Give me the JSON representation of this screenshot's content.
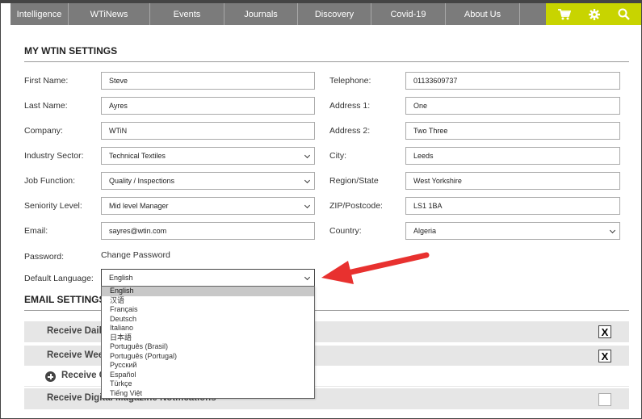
{
  "nav": {
    "items": [
      "Intelligence",
      "WTiNews",
      "Events",
      "Journals",
      "Discovery",
      "Covid-19",
      "About Us"
    ]
  },
  "icons": {
    "cart": "cart-icon",
    "settings": "gear-icon",
    "search": "search-icon"
  },
  "colors": {
    "nav_bg": "#7b7b7b",
    "accent": "#c8d400",
    "arrow": "#e8312f",
    "row_bg": "#e6e6e6"
  },
  "wtin_settings": {
    "title": "MY WTIN SETTINGS",
    "first_name": {
      "label": "First Name:",
      "value": "Steve"
    },
    "last_name": {
      "label": "Last Name:",
      "value": "Ayres"
    },
    "company": {
      "label": "Company:",
      "value": "WTiN"
    },
    "industry_sector": {
      "label": "Industry Sector:",
      "value": "Technical Textiles"
    },
    "job_function": {
      "label": "Job Function:",
      "value": "Quality / Inspections"
    },
    "seniority_level": {
      "label": "Seniority Level:",
      "value": "Mid level Manager"
    },
    "email": {
      "label": "Email:",
      "value": "sayres@wtin.com"
    },
    "password": {
      "label": "Password:",
      "link": "Change Password"
    },
    "default_language": {
      "label": "Default Language:",
      "value": "English"
    },
    "telephone": {
      "label": "Telephone:",
      "value": "01133609737"
    },
    "address1": {
      "label": "Address 1:",
      "value": "One"
    },
    "address2": {
      "label": "Address 2:",
      "value": "Two Three"
    },
    "city": {
      "label": "City:",
      "value": "Leeds"
    },
    "region": {
      "label": "Region/State",
      "value": "West Yorkshire"
    },
    "zip": {
      "label": "ZIP/Postcode:",
      "value": "LS1 1BA"
    },
    "country": {
      "label": "Country:",
      "value": "Algeria"
    }
  },
  "language_options": [
    "English",
    "汉语",
    "Français",
    "Deutsch",
    "Italiano",
    "日本語",
    "Português (Brasil)",
    "Português (Portugal)",
    "Русский",
    "Español",
    "Türkçe",
    "Tiếng Việt"
  ],
  "email_settings": {
    "title": "EMAIL SETTINGS",
    "rows": [
      {
        "label": "Receive Daily",
        "check": "X"
      },
      {
        "label": "Receive Wee",
        "check": "X"
      },
      {
        "label": "Receive Cha",
        "check": ""
      },
      {
        "label": "Receive Digital Magazine Notifications",
        "check": ""
      }
    ]
  }
}
